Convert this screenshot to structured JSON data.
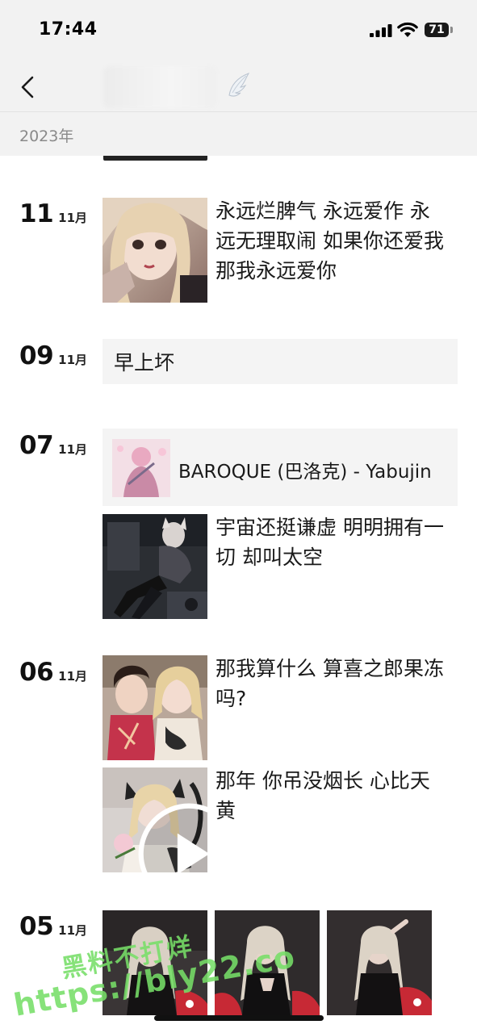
{
  "status_bar": {
    "time": "17:44",
    "battery": "71"
  },
  "header": {
    "year": "2023年"
  },
  "entries": [
    {
      "day": "11",
      "month": "11月",
      "posts": [
        {
          "caption": "永远烂脾气 永远爱作 永远无理取闹 如果你还爱我 那我永远爱你"
        }
      ]
    },
    {
      "day": "09",
      "month": "11月",
      "posts": [
        {
          "text": "早上坏"
        }
      ]
    },
    {
      "day": "07",
      "month": "11月",
      "posts": [
        {
          "music": "BAROQUE (巴洛克) - Yabujin"
        },
        {
          "caption": "宇宙还挺谦虚 明明拥有一切 却叫太空"
        }
      ]
    },
    {
      "day": "06",
      "month": "11月",
      "posts": [
        {
          "caption": "那我算什么 算喜之郎果冻吗?"
        },
        {
          "caption": "那年 你吊没烟长 心比天黄",
          "video": true
        }
      ]
    },
    {
      "day": "05",
      "month": "11月",
      "posts": [
        {
          "photos": 3
        }
      ]
    }
  ],
  "watermark": {
    "line1": "黑料不打烊",
    "line2": "https://bly22.co"
  },
  "colors": {
    "page_bg": "#ffffff",
    "bar_bg": "#f2f2f2",
    "card_bg": "#f4f4f4",
    "watermark": "#76de68"
  }
}
